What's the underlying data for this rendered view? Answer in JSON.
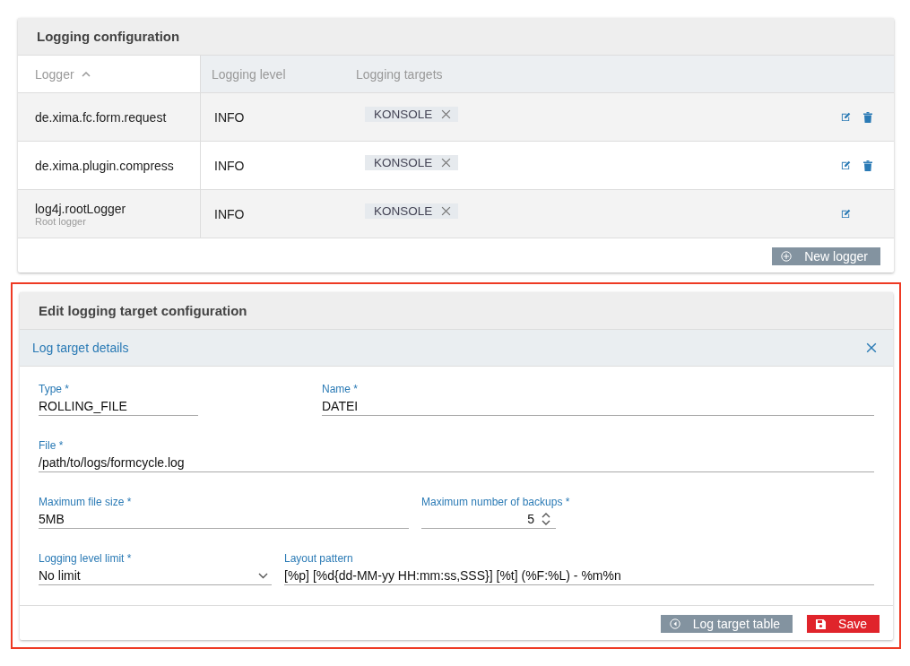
{
  "logging_panel": {
    "title": "Logging configuration",
    "columns": [
      {
        "label": "Logger",
        "sorted": true
      },
      {
        "label": "Logging level",
        "sorted": false
      },
      {
        "label": "Logging targets",
        "sorted": false
      }
    ],
    "rows": [
      {
        "logger": "de.xima.fc.form.request",
        "level": "INFO",
        "targets": [
          "KONSOLE"
        ],
        "editable": true,
        "deletable": true
      },
      {
        "logger": "de.xima.plugin.compress",
        "level": "INFO",
        "targets": [
          "KONSOLE"
        ],
        "editable": true,
        "deletable": true
      },
      {
        "logger": "log4j.rootLogger",
        "subtitle": "Root logger",
        "level": "INFO",
        "targets": [
          "KONSOLE"
        ],
        "editable": true,
        "deletable": false
      }
    ],
    "button": "New logger"
  },
  "edit_panel": {
    "title": "Edit logging target configuration",
    "highlighted": true,
    "section_title": "Log target details",
    "form_rows": [
      [
        {
          "kind": "text",
          "label": "Type *",
          "value": "ROLLING_FILE"
        },
        {
          "kind": "text",
          "label": "Name *",
          "value": "DATEI"
        }
      ],
      [
        {
          "kind": "text",
          "label": "File *",
          "value": "/path/to/logs/formcycle.log"
        }
      ],
      [
        {
          "kind": "text",
          "label": "Maximum file size *",
          "value": "5MB"
        },
        {
          "kind": "number",
          "label": "Maximum number of backups *",
          "value": "5"
        }
      ],
      [
        {
          "kind": "select",
          "label": "Logging level limit *",
          "value": "No limit"
        },
        {
          "kind": "text",
          "label": "Layout pattern",
          "value": "[%p] [%d{dd-MM-yy HH:mm:ss,SSS}] [%t] (%F:%L) - %m%n"
        }
      ]
    ],
    "buttons": [
      {
        "kind": "secondary",
        "label": "Log target table"
      },
      {
        "kind": "danger",
        "label": "Save"
      }
    ]
  }
}
